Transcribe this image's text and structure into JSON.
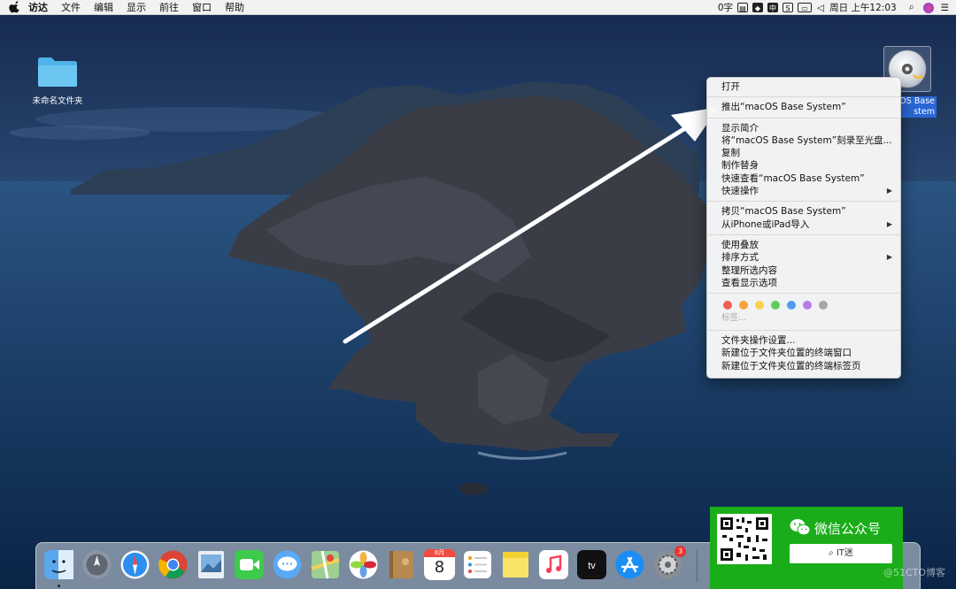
{
  "menubar": {
    "app_name": "访达",
    "items": [
      "文件",
      "编辑",
      "显示",
      "前往",
      "窗口",
      "帮助"
    ],
    "status": {
      "input_count": "0字",
      "ime": "中",
      "datetime": "周日 上午12:03"
    }
  },
  "desktop": {
    "folder_label": "未命名文件夹",
    "dvd_label_line1": "OS Base",
    "dvd_label_line2": "stem"
  },
  "context_menu": {
    "open": "打开",
    "eject": "推出“macOS Base System”",
    "get_info": "显示简介",
    "burn": "将“macOS Base System”刻录至光盘...",
    "duplicate": "复制",
    "make_alias": "制作替身",
    "quick_look": "快速查看“macOS Base System”",
    "quick_actions": "快速操作",
    "copy": "拷贝“macOS Base System”",
    "import_iphone": "从iPhone或iPad导入",
    "use_stacks": "使用叠放",
    "sort_by": "排序方式",
    "clean_up": "整理所选内容",
    "view_options": "查看显示选项",
    "tags": "标签...",
    "folder_actions": "文件夹操作设置...",
    "new_terminal": "新建位于文件夹位置的终端窗口",
    "new_terminal_tab": "新建位于文件夹位置的终端标签页",
    "tag_colors": [
      "#f25f58",
      "#f6a33b",
      "#f5d34a",
      "#5fcd5a",
      "#4f9cf2",
      "#b57be8",
      "#a5a5a5"
    ]
  },
  "dock": {
    "calendar_day": "8",
    "calendar_month": "8月",
    "sysprefs_badge": "3",
    "apps": [
      "finder-icon",
      "launchpad-icon",
      "safari-icon",
      "chrome-icon",
      "preview-icon",
      "facetime-icon",
      "messages-icon",
      "maps-icon",
      "photos-icon",
      "notes-icon",
      "calendar-icon",
      "reminders-icon",
      "stickies-icon",
      "music-icon",
      "tv-icon",
      "appstore-icon",
      "system-preferences-icon"
    ]
  },
  "wechat": {
    "title": "微信公众号",
    "search_text": "IT迷",
    "watermark": "@51CTO博客"
  },
  "colors": {
    "accent": "#2a67d6",
    "wechat_green": "#1aad19"
  }
}
